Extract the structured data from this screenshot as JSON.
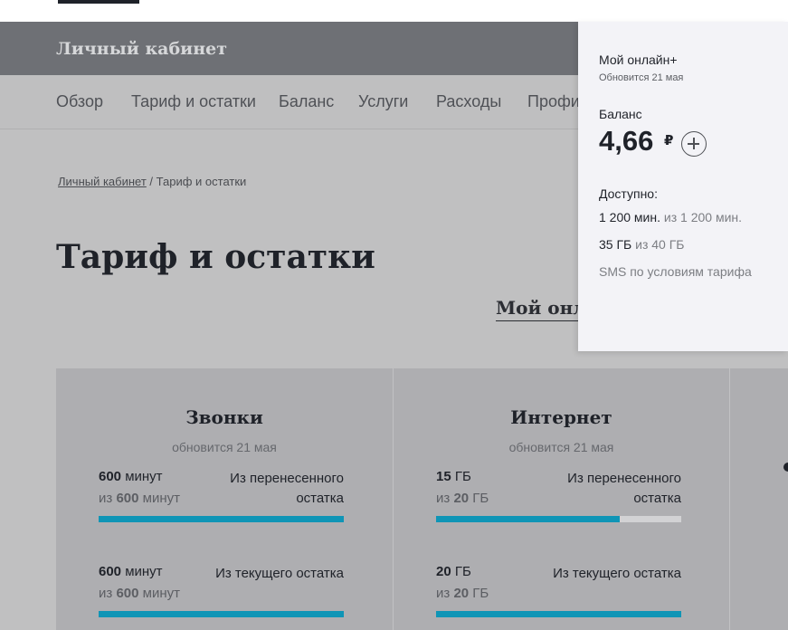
{
  "header": {
    "title": "Личный кабинет"
  },
  "nav": {
    "items": [
      "Обзор",
      "Тариф и остатки",
      "Баланс",
      "Услуги",
      "Расходы",
      "Профиль"
    ]
  },
  "breadcrumb": {
    "home": "Личный кабинет",
    "separator": " / ",
    "current": "Тариф и остатки"
  },
  "page": {
    "title": "Тариф и остатки",
    "tariff_link": "Мой онлайн+"
  },
  "cards": [
    {
      "title": "Звонки",
      "updated": "обновится 21 мая",
      "rows": [
        {
          "amount": "600",
          "unit": " минут",
          "prefix": "из ",
          "total": "600",
          "total_unit": " минут",
          "label": "Из перенесенного остатка",
          "fill": 1.0
        },
        {
          "amount": "600",
          "unit": " минут",
          "prefix": "из ",
          "total": "600",
          "total_unit": " минут",
          "label": "Из текущего остатка",
          "fill": 1.0
        }
      ]
    },
    {
      "title": "Интернет",
      "updated": "обновится 21 мая",
      "rows": [
        {
          "amount": "15",
          "unit": " ГБ",
          "prefix": "из ",
          "total": "20",
          "total_unit": " ГБ",
          "label": "Из перенесенного остатка",
          "fill": 0.75
        },
        {
          "amount": "20",
          "unit": " ГБ",
          "prefix": "из ",
          "total": "20",
          "total_unit": " ГБ",
          "label": "Из текущего остатка",
          "fill": 1.0
        }
      ]
    }
  ],
  "popup": {
    "tariff": "Мой онлайн+",
    "updated": "Обновится 21 мая",
    "balance_label": "Баланс",
    "balance": "4,66",
    "currency": "₽",
    "plus_icon": "plus-circle-icon",
    "available_label": "Доступно:",
    "minutes_left": "1 200 мин.",
    "minutes_total": " из 1 200 мин.",
    "data_left": "35 ГБ",
    "data_total": " из 40 ГБ",
    "sms": "SMS по условиям тарифа"
  },
  "colors": {
    "accent": "#0f95b6",
    "header": "#6e7075",
    "popup_bg": "#f3f3f7"
  }
}
